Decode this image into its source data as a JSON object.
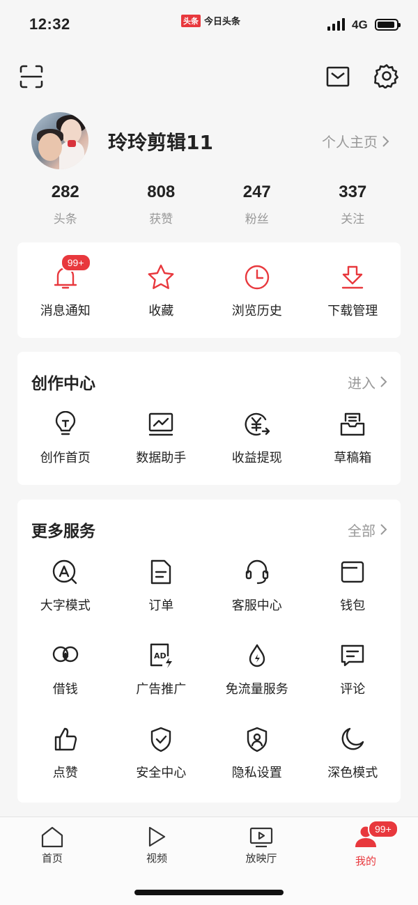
{
  "status_bar": {
    "time": "12:32",
    "app_logo": "头条",
    "app_name": "今日头条",
    "network": "4G"
  },
  "header": {
    "scan_icon": "scan-icon",
    "mail_icon": "mail-icon",
    "settings_icon": "gear-icon"
  },
  "profile": {
    "username": "玲玲剪辑11",
    "homepage_label": "个人主页",
    "stats": [
      {
        "value": "282",
        "label": "头条"
      },
      {
        "value": "808",
        "label": "获赞"
      },
      {
        "value": "247",
        "label": "粉丝"
      },
      {
        "value": "337",
        "label": "关注"
      }
    ]
  },
  "quick_actions": {
    "items": [
      {
        "label": "消息通知",
        "icon": "bell-icon",
        "badge": "99+"
      },
      {
        "label": "收藏",
        "icon": "star-icon"
      },
      {
        "label": "浏览历史",
        "icon": "clock-icon"
      },
      {
        "label": "下载管理",
        "icon": "download-icon"
      }
    ]
  },
  "creation_center": {
    "title": "创作中心",
    "link": "进入",
    "items": [
      {
        "label": "创作首页",
        "icon": "lightbulb-icon"
      },
      {
        "label": "数据助手",
        "icon": "chart-monitor-icon"
      },
      {
        "label": "收益提现",
        "icon": "yuan-icon"
      },
      {
        "label": "草稿箱",
        "icon": "draft-box-icon"
      }
    ]
  },
  "more_services": {
    "title": "更多服务",
    "link": "全部",
    "items": [
      {
        "label": "大字模式",
        "icon": "large-font-icon"
      },
      {
        "label": "订单",
        "icon": "order-icon"
      },
      {
        "label": "客服中心",
        "icon": "headset-icon"
      },
      {
        "label": "钱包",
        "icon": "wallet-icon"
      },
      {
        "label": "借钱",
        "icon": "loan-icon"
      },
      {
        "label": "广告推广",
        "icon": "ad-icon"
      },
      {
        "label": "免流量服务",
        "icon": "data-free-icon"
      },
      {
        "label": "评论",
        "icon": "comment-icon"
      },
      {
        "label": "点赞",
        "icon": "thumbs-up-icon"
      },
      {
        "label": "安全中心",
        "icon": "shield-check-icon"
      },
      {
        "label": "隐私设置",
        "icon": "privacy-icon"
      },
      {
        "label": "深色模式",
        "icon": "moon-icon"
      }
    ]
  },
  "tabbar": {
    "tabs": [
      {
        "label": "首页",
        "icon": "home-icon"
      },
      {
        "label": "视频",
        "icon": "play-icon"
      },
      {
        "label": "放映厅",
        "icon": "theater-icon"
      },
      {
        "label": "我的",
        "icon": "profile-icon",
        "badge": "99+",
        "active": true
      }
    ]
  },
  "colors": {
    "accent": "#e8383d",
    "text": "#222222",
    "muted": "#999999",
    "background": "#f6f6f6"
  }
}
